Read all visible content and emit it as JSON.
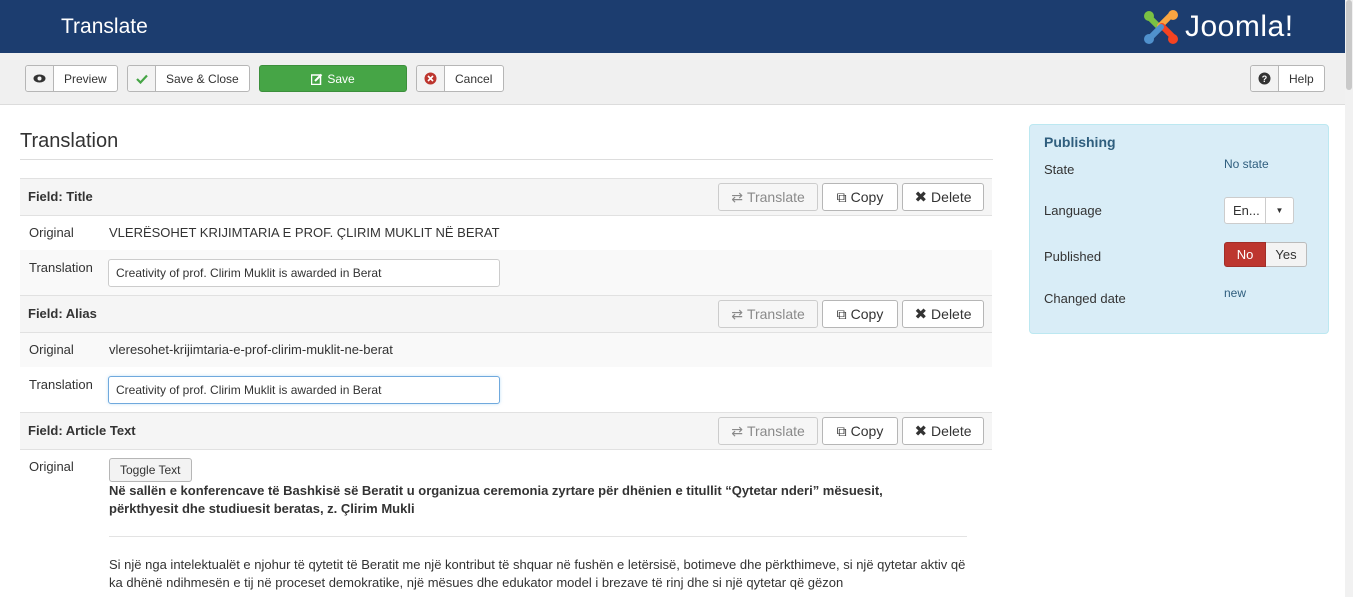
{
  "header": {
    "title": "Translate",
    "logo_text": "Joomla!"
  },
  "toolbar": {
    "preview": "Preview",
    "save_close": "Save & Close",
    "save": "Save",
    "cancel": "Cancel",
    "help": "Help"
  },
  "main": {
    "section_title": "Translation",
    "buttons": {
      "translate": "Translate",
      "copy": "Copy",
      "delete": "Delete"
    },
    "labels": {
      "original": "Original",
      "translation": "Translation"
    },
    "fields": [
      {
        "label": "Field: Title",
        "original": "VLERËSOHET KRIJIMTARIA E PROF. ÇLIRIM MUKLIT NË BERAT",
        "translation": "Creativity of prof. Clirim Muklit is awarded in Berat"
      },
      {
        "label": "Field: Alias",
        "original": "vleresohet-krijimtaria-e-prof-clirim-muklit-ne-berat",
        "translation": "Creativity of prof. Clirim Muklit is awarded in Berat"
      },
      {
        "label": "Field: Article Text",
        "toggle": "Toggle Text",
        "original_bold": "Në sallën e konferencave të Bashkisë së Beratit u organizua ceremonia zyrtare për dhënien e titullit “Qytetar nderi” mësuesit, përkthyesit dhe studiuesit beratas, z. Çlirim Mukli",
        "original_para": "Si një nga intelektualët e njohur të qytetit të Beratit me një kontribut të shquar në fushën e letërsisë, botimeve dhe përkthimeve, si një qytetar aktiv që ka dhënë ndihmesën e tij në proceset demokratike, një mësues dhe edukator model i brezave të rinj dhe si një qytetar që gëzon"
      }
    ]
  },
  "publishing": {
    "title": "Publishing",
    "state_label": "State",
    "state_value": "No state",
    "language_label": "Language",
    "language_value": "En...",
    "published_label": "Published",
    "published_no": "No",
    "published_yes": "Yes",
    "changed_label": "Changed date",
    "changed_value": "new"
  },
  "colors": {
    "header": "#1c3d6f",
    "save": "#46a546",
    "no_active": "#bd362f",
    "panel": "#d9edf7"
  }
}
